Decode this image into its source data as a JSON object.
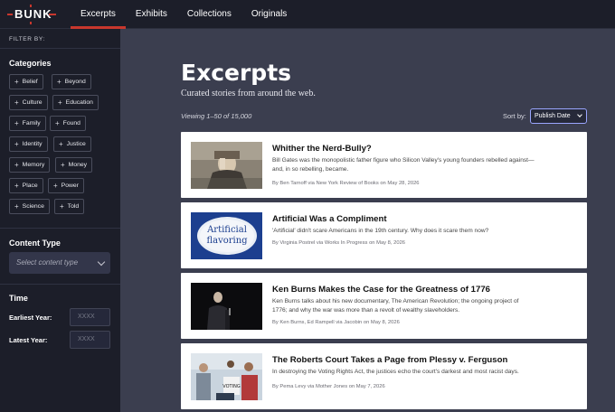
{
  "brand": {
    "logo_text": "BUNK",
    "accent": "#c8372d"
  },
  "nav": [
    "Excerpts",
    "Exhibits",
    "Collections",
    "Originals"
  ],
  "sidebar": {
    "filter_by": "FILTER BY:",
    "categories_title": "Categories",
    "categories": [
      "Belief",
      "Beyond",
      "Culture",
      "Education",
      "Family",
      "Found",
      "Identity",
      "Justice",
      "Memory",
      "Money",
      "Place",
      "Power",
      "Science",
      "Told"
    ],
    "content_type_title": "Content Type",
    "content_type_placeholder": "Select content type",
    "time_title": "Time",
    "earliest_label": "Earliest Year:",
    "latest_label": "Latest Year:",
    "year_placeholder": "XXXX"
  },
  "main": {
    "title": "Excerpts",
    "subtitle": "Curated stories from around the web.",
    "viewing": "Viewing 1–50 of 15,000",
    "sort_label": "Sort by:",
    "sort_value": "Publish Date",
    "cards": [
      {
        "title": "Whither the Nerd-Bully?",
        "desc": "Bill Gates was the monopolistic father figure who Silicon Valley's young founders rebelled against—and, in so rebelling, became.",
        "meta": "By Ben Tarnoff via New York Review of Books on May 28, 2026"
      },
      {
        "title": "Artificial Was a Compliment",
        "desc": "'Artificial' didn't scare Americans in the 19th century. Why does it scare them now?",
        "meta": "By Virginia Postrel via Works In Progress on May 8, 2026",
        "thumb_text_1": "Artificial",
        "thumb_text_2": "flavoring"
      },
      {
        "title": "Ken Burns Makes the Case for the Greatness of 1776",
        "desc": "Ken Burns talks about his new documentary, The American Revolution; the ongoing project of 1776; and why the war was more than a revolt of wealthy slaveholders.",
        "meta": "By Ken Burns, Ed Rampell via Jacobin on May 8, 2026"
      },
      {
        "title": "The Roberts Court Takes a Page from Plessy v. Ferguson",
        "desc": "In destroying the Voting Rights Act, the justices echo the court's darkest and most racist days.",
        "meta": "By Pema Levy via Mother Jones on May 7, 2026",
        "thumb_text_1": "VOTING"
      }
    ]
  }
}
